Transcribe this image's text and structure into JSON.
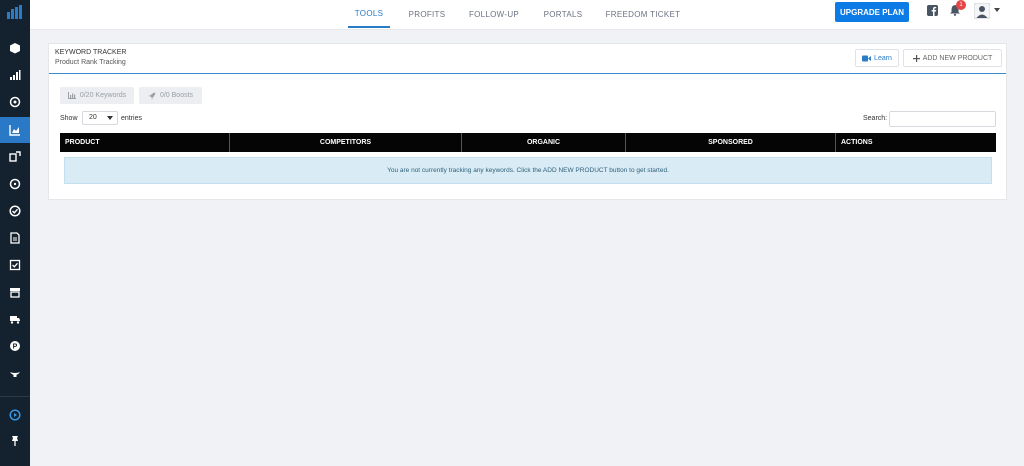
{
  "nav": {
    "tabs": [
      {
        "label": "TOOLS",
        "active": true
      },
      {
        "label": "PROFITS",
        "active": false
      },
      {
        "label": "FOLLOW-UP",
        "active": false
      },
      {
        "label": "PORTALS",
        "active": false
      },
      {
        "label": "FREEDOM TICKET",
        "active": false
      }
    ],
    "upgrade_label": "UPGRADE PLAN",
    "notification_count": "1",
    "accent_color": "#0d7be6"
  },
  "sidebar": {
    "icons": [
      "cube-icon",
      "signal-bars-icon",
      "globe-icon",
      "chart-icon",
      "exchange-icon",
      "compass-icon",
      "check-circle-icon",
      "document-icon",
      "checkbox-icon",
      "box-icon",
      "truck-icon",
      "p-badge-icon",
      "genie-lamp-icon",
      "play-circle-icon",
      "pin-icon"
    ],
    "active_icon": "chart-icon"
  },
  "card": {
    "title": "KEYWORD TRACKER",
    "subtitle": "Product Rank Tracking",
    "learn_label": "Learn",
    "add_product_label": "ADD NEW PRODUCT",
    "keywords_pill": "0/20 Keywords",
    "boosts_pill": "0/0 Boosts",
    "show_label": "Show",
    "show_value": "20",
    "entries_label": "entries",
    "search_label": "Search:",
    "columns": [
      "PRODUCT",
      "COMPETITORS",
      "ORGANIC",
      "SPONSORED",
      "ACTIONS"
    ],
    "empty_message": "You are not currently tracking any keywords. Click the ADD NEW PRODUCT button to get started."
  }
}
